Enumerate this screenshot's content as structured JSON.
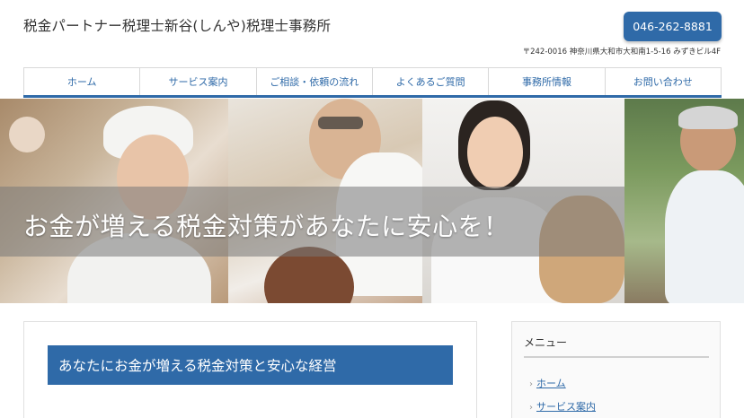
{
  "header": {
    "site_title": "税金パートナー税理士新谷(しんや)税理士事務所",
    "phone": "046-262-8881",
    "address": "〒242-0016 神奈川県大和市大和南1-5-16 みずきビル4F"
  },
  "nav": {
    "items": [
      {
        "label": "ホーム"
      },
      {
        "label": "サービス案内"
      },
      {
        "label": "ご相談・依頼の流れ"
      },
      {
        "label": "よくあるご質問"
      },
      {
        "label": "事務所情報"
      },
      {
        "label": "お問い合わせ"
      }
    ]
  },
  "hero": {
    "tagline": "お金が増える税金対策があなたに安心を！"
  },
  "main": {
    "heading": "あなたにお金が増える税金対策と安心な経営"
  },
  "sidebar": {
    "title": "メニュー",
    "links": [
      {
        "label": "ホーム"
      },
      {
        "label": "サービス案内"
      }
    ]
  },
  "colors": {
    "accent": "#2f6aa8",
    "text": "#333333",
    "border": "#d8d8d8"
  }
}
